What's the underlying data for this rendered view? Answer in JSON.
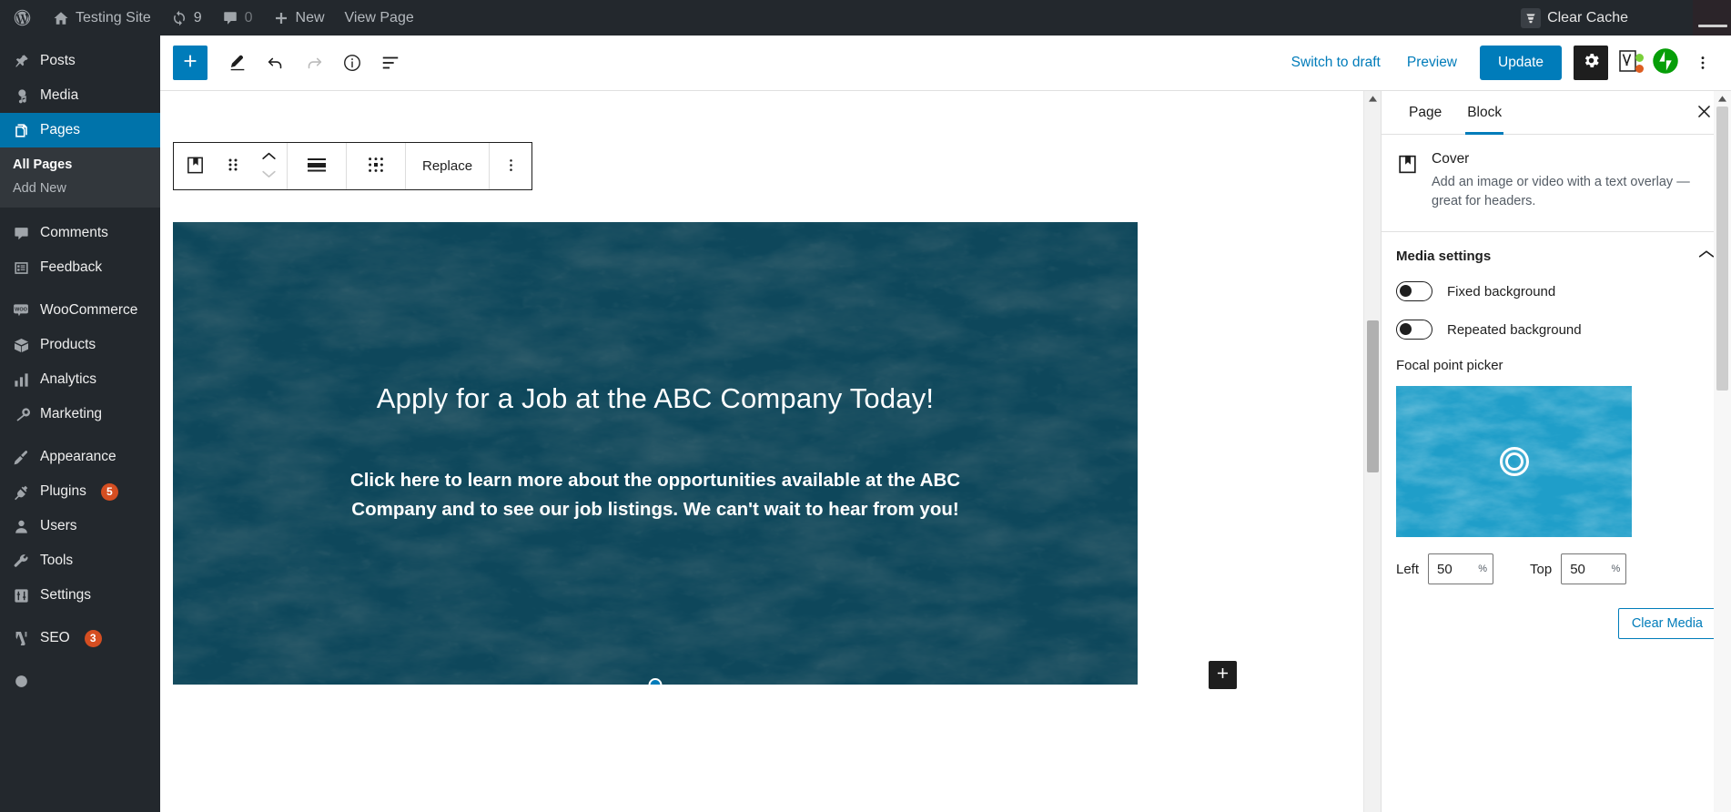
{
  "admin_bar": {
    "wp_logo_icon": "wordpress-logo-icon",
    "site_icon": "home-icon",
    "site_name": "Testing Site",
    "updates_icon": "updates-icon",
    "updates_count": "9",
    "comments_icon": "comment-bubble-icon",
    "comments_count": "0",
    "new_icon": "plus-icon",
    "new_label": "New",
    "view_page_label": "View Page",
    "clear_cache_icon": "cache-bucket-icon",
    "clear_cache_label": "Clear Cache"
  },
  "sidebar": {
    "items": [
      {
        "label": "Posts",
        "icon": "pin-icon",
        "name": "posts",
        "current": false,
        "badge": ""
      },
      {
        "label": "Media",
        "icon": "media-icon",
        "name": "media",
        "current": false,
        "badge": ""
      },
      {
        "label": "Pages",
        "icon": "pages-icon",
        "name": "pages",
        "current": true,
        "badge": ""
      },
      {
        "label": "Comments",
        "icon": "comment-icon",
        "name": "comments",
        "current": false,
        "badge": ""
      },
      {
        "label": "Feedback",
        "icon": "feedback-icon",
        "name": "feedback",
        "current": false,
        "badge": ""
      },
      {
        "label": "WooCommerce",
        "icon": "woocommerce-icon",
        "name": "woocommerce",
        "current": false,
        "badge": ""
      },
      {
        "label": "Products",
        "icon": "products-icon",
        "name": "products",
        "current": false,
        "badge": ""
      },
      {
        "label": "Analytics",
        "icon": "analytics-icon",
        "name": "analytics",
        "current": false,
        "badge": ""
      },
      {
        "label": "Marketing",
        "icon": "megaphone-icon",
        "name": "marketing",
        "current": false,
        "badge": ""
      },
      {
        "label": "Appearance",
        "icon": "paintbrush-icon",
        "name": "appearance",
        "current": false,
        "badge": ""
      },
      {
        "label": "Plugins",
        "icon": "plug-icon",
        "name": "plugins",
        "current": false,
        "badge": "5"
      },
      {
        "label": "Users",
        "icon": "user-icon",
        "name": "users",
        "current": false,
        "badge": ""
      },
      {
        "label": "Tools",
        "icon": "wrench-icon",
        "name": "tools",
        "current": false,
        "badge": ""
      },
      {
        "label": "Settings",
        "icon": "sliders-icon",
        "name": "settings",
        "current": false,
        "badge": ""
      },
      {
        "label": "SEO",
        "icon": "yoast-icon",
        "name": "seo",
        "current": false,
        "badge": "3"
      }
    ],
    "submenu": {
      "parent": "pages",
      "items": [
        {
          "label": "All Pages",
          "current": true
        },
        {
          "label": "Add New",
          "current": false
        }
      ]
    }
  },
  "editor_header": {
    "add_block_icon": "plus-icon",
    "tools_icon": "pencil-icon",
    "undo_icon": "undo-arrow-icon",
    "redo_icon": "redo-arrow-icon",
    "details_icon": "info-circle-icon",
    "list_view_icon": "list-view-icon",
    "switch_to_draft_label": "Switch to draft",
    "preview_label": "Preview",
    "update_label": "Update",
    "settings_gear_icon": "gear-icon",
    "yoast_icon": "yoast-seo-icon",
    "jetpack_icon": "jetpack-icon",
    "more_menu_icon": "three-dots-vertical-icon"
  },
  "block_toolbar": {
    "block_type_icon": "cover-block-icon",
    "drag_handle_icon": "drag-dots-icon",
    "move_up_icon": "chevron-up-icon",
    "move_down_icon": "chevron-down-icon",
    "align_icon": "align-full-width-icon",
    "content_position_icon": "content-position-grid-icon",
    "replace_label": "Replace",
    "options_icon": "three-dots-vertical-icon"
  },
  "cover_block": {
    "heading": "Apply for a Job at the ABC Company Today!",
    "paragraph": "Click here to learn more about the opportunities available at the ABC Company and to see our job listings. We can't wait to hear from you!",
    "resize_handle_name": "cover-resize-handle",
    "background_color": "#14566b",
    "overlay_color": "#093c4e"
  },
  "canvas": {
    "block_appender_icon": "plus-icon"
  },
  "settings_panel": {
    "tabs": [
      {
        "label": "Page",
        "active": false
      },
      {
        "label": "Block",
        "active": true
      }
    ],
    "close_icon": "close-x-icon",
    "block_card": {
      "icon": "cover-block-icon",
      "title": "Cover",
      "description": "Add an image or video with a text overlay — great for headers."
    },
    "media_settings": {
      "title": "Media settings",
      "collapse_icon": "chevron-up-icon",
      "toggles": [
        {
          "label": "Fixed background",
          "on": false
        },
        {
          "label": "Repeated background",
          "on": false
        }
      ],
      "focal_point": {
        "label": "Focal point picker",
        "target_icon": "focal-point-target-icon",
        "left_label": "Left",
        "left_value": "50",
        "left_suffix": "%",
        "top_label": "Top",
        "top_value": "50",
        "top_suffix": "%"
      },
      "clear_media_label": "Clear Media"
    }
  },
  "colors": {
    "wp_blue": "#007cba",
    "admin_dark": "#23282d",
    "badge_orange": "#d54e21",
    "submenu_bg": "#32373c"
  }
}
